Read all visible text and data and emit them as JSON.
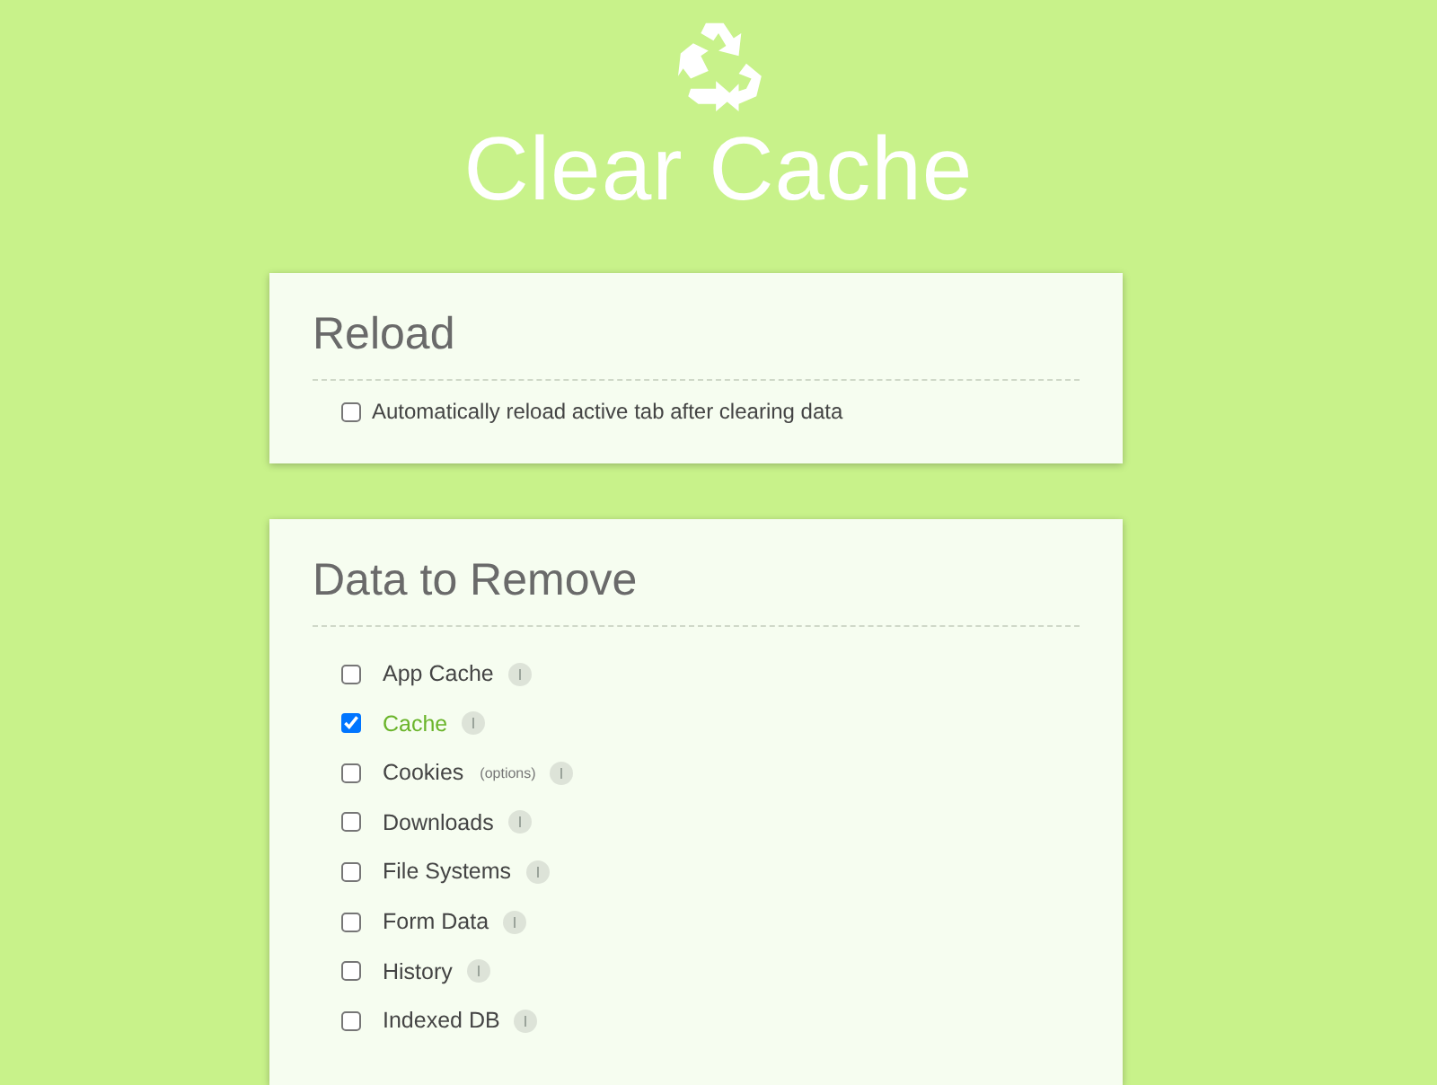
{
  "header": {
    "title": "Clear Cache"
  },
  "reload": {
    "heading": "Reload",
    "option": {
      "label": "Automatically reload active tab after clearing data",
      "checked": false
    }
  },
  "data_to_remove": {
    "heading": "Data to Remove",
    "items": [
      {
        "label": "App Cache",
        "checked": false
      },
      {
        "label": "Cache",
        "checked": true
      },
      {
        "label": "Cookies",
        "checked": false,
        "note": "(options)"
      },
      {
        "label": "Downloads",
        "checked": false
      },
      {
        "label": "File Systems",
        "checked": false
      },
      {
        "label": "Form Data",
        "checked": false
      },
      {
        "label": "History",
        "checked": false
      },
      {
        "label": "Indexed DB",
        "checked": false
      }
    ]
  }
}
